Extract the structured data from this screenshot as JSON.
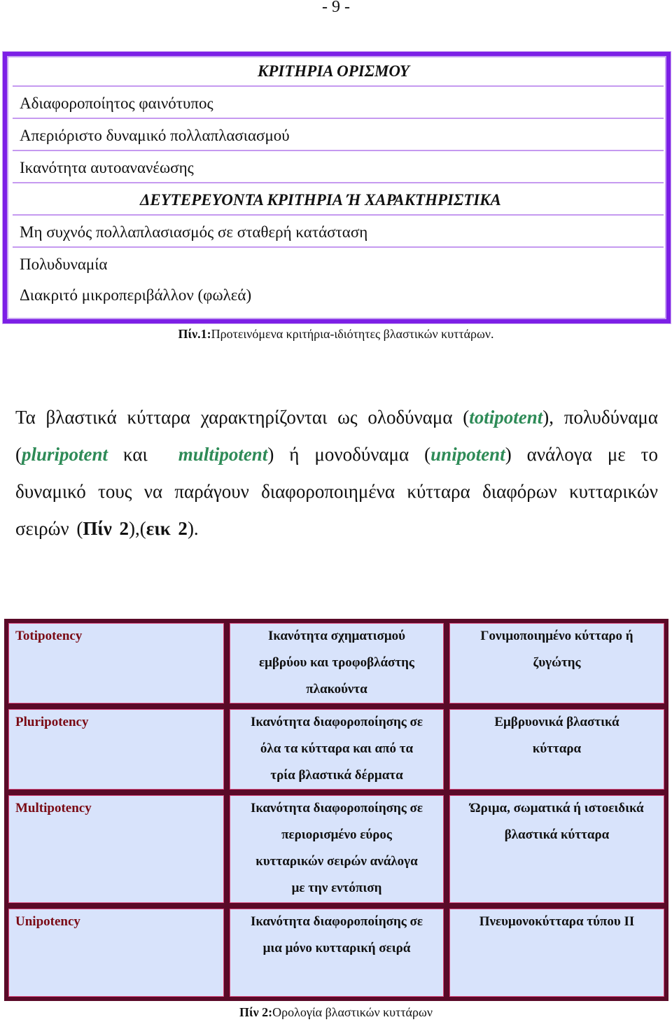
{
  "page_number": "- 9 -",
  "table1": {
    "header_primary": "ΚΡΙΤΗΡΙΑ ΟΡΙΣΜΟΥ",
    "primary_items": [
      "Αδιαφοροποίητος φαινότυπος",
      "Απεριόριστο δυναμικό πολλαπλασιασμού",
      "Ικανότητα αυτοανανέωσης"
    ],
    "header_secondary": "ΔΕΥΤΕΡΕΥΟΝΤΑ ΚΡΙΤΗΡΙΑ Ή ΧΑΡΑΚΤΗΡΙΣΤΙΚΑ",
    "secondary_items": [
      "Μη συχνός πολλαπλασιασμός σε σταθερή κατάσταση",
      "Πολυδυναμία",
      "Διακριτό μικροπεριβάλλον (φωλεά)"
    ],
    "caption_label": "Πίν.1:",
    "caption_text": "Προτεινόμενα κριτήρια-ιδιότητες βλαστικών κυττάρων."
  },
  "paragraph": {
    "p1": "Τα βλαστικά κύτταρα χαρακτηρίζονται ως ολοδύναμα (",
    "term_totipotent": "totipotent",
    "p2": "), πολυδύναμα (",
    "term_pluripotent": "pluripotent",
    "p3": " και  ",
    "term_multipotent": "multipotent",
    "p4": ") ή μονοδύναμα (",
    "term_unipotent": "unipotent",
    "p5": ") ανάλογα με το δυναμικό τους να παράγουν διαφοροποιημένα κύτταρα διαφόρων κυτταρικών σειρών (",
    "ref_table": "Πίν 2",
    "p6": "),(",
    "ref_figure": "εικ 2",
    "p7": ")."
  },
  "table2": {
    "rows": [
      {
        "term": "Totipotency",
        "capacity": [
          "Ικανότητα σχηματισμού",
          "εμβρύου και τροφοβλάστης",
          "πλακούντα"
        ],
        "example": [
          "Γονιμοποιημένο κύτταρο ή",
          "ζυγώτης"
        ]
      },
      {
        "term": "Pluripotency",
        "capacity": [
          "Ικανότητα διαφοροποίησης σε",
          "όλα τα κύτταρα και από τα",
          "τρία βλαστικά δέρματα"
        ],
        "example": [
          "Εμβρυονικά βλαστικά",
          "κύτταρα"
        ]
      },
      {
        "term": "Multipotency",
        "capacity": [
          "Ικανότητα διαφοροποίησης σε",
          "περιορισμένο εύρος",
          "κυτταρικών σειρών ανάλογα",
          "με την εντόπιση"
        ],
        "example": [
          "Ώριμα, σωματικά ή ιστοειδικά",
          "βλαστικά κύτταρα"
        ]
      },
      {
        "term": "Unipotency",
        "capacity": [
          "Ικανότητα διαφοροποίησης σε",
          "μια μόνο κυτταρική σειρά"
        ],
        "example": [
          "Πνευμονοκύτταρα τύπου ΙΙ"
        ]
      }
    ],
    "caption_label": "Πίν 2:",
    "caption_text": "Ορολογία βλαστικών κυττάρων"
  },
  "colors": {
    "table1_border": "#7c1fe6",
    "table1_rule": "#c59af0",
    "table2_border": "#5a0a28",
    "table2_fill": "#d8e3fb",
    "term_red": "#7a0a14",
    "term_green": "#2e8b57"
  }
}
